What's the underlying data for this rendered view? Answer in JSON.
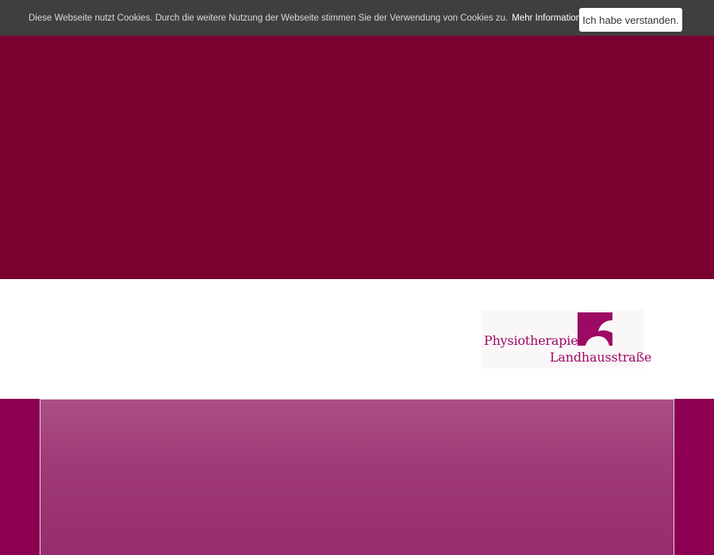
{
  "cookie_banner": {
    "text": "Diese Webseite nutzt Cookies. Durch die weitere Nutzung der Webseite stimmen Sie der Verwendung von Cookies zu.",
    "more_info_label": "Mehr Informationen",
    "accept_label": "Ich habe verstanden."
  },
  "logo": {
    "line1": "Physiotherapie",
    "line2": "Landhausstraße"
  },
  "colors": {
    "banner": "#3f3f3f",
    "hero": "#7a0030",
    "accent": "#9c0a64",
    "lower": "#8c0052"
  }
}
